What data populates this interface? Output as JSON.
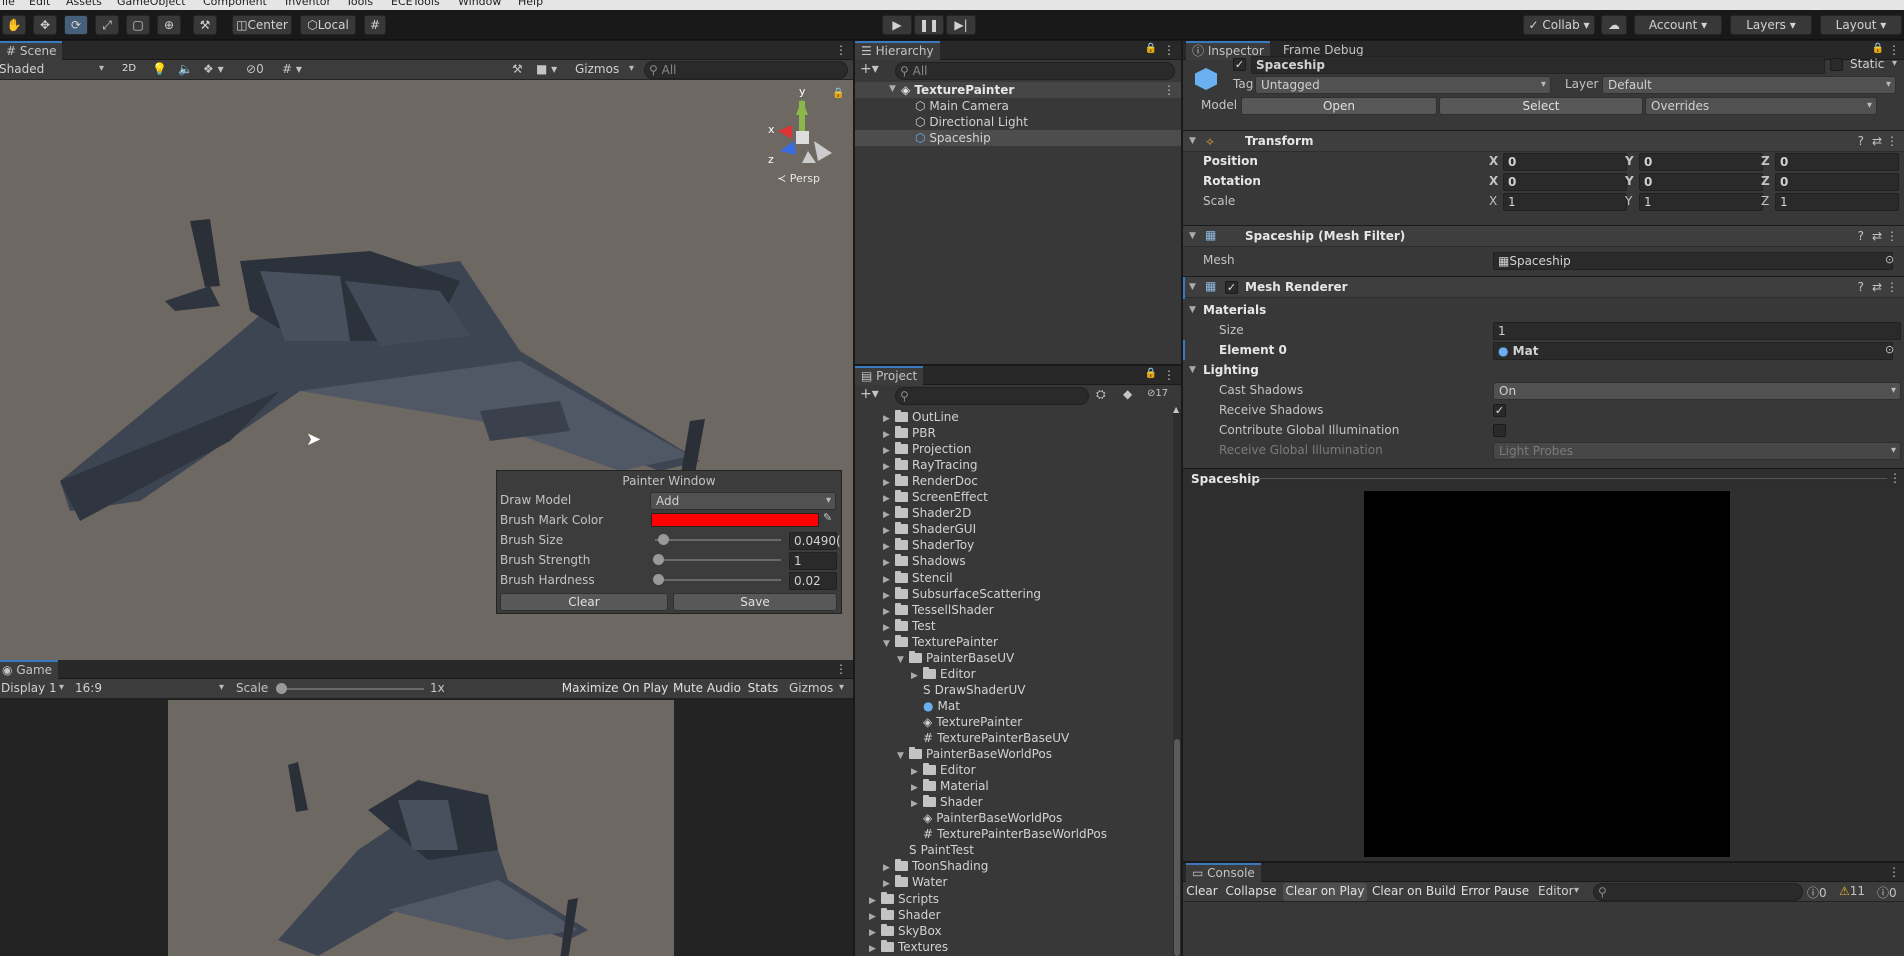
{
  "menubar": [
    "ile",
    "Edit",
    "Assets",
    "GameObject",
    "Component",
    "Inventor",
    "Tools",
    "ECETools",
    "Window",
    "Help"
  ],
  "toolbar": {
    "pivot_center": "Center",
    "pivot_local": "Local",
    "collab": "Collab",
    "account": "Account",
    "layers": "Layers",
    "layout": "Layout"
  },
  "scene": {
    "tab": "Scene",
    "shading": "Shaded",
    "mode_2d": "2D",
    "hidden_count": "0",
    "gizmos": "Gizmos",
    "search_placeholder": "All",
    "persp": "Persp",
    "axis_x": "x",
    "axis_y": "y",
    "axis_z": "z"
  },
  "painter": {
    "title": "Painter Window",
    "draw_model_label": "Draw Model",
    "draw_model_value": "Add",
    "color_label": "Brush Mark Color",
    "color_value": "#ff0000",
    "size_label": "Brush Size",
    "size_value": "0.0490(",
    "size_fraction": 0.04,
    "strength_label": "Brush Strength",
    "strength_value": "1",
    "strength_fraction": 0.0,
    "hardness_label": "Brush Hardness",
    "hardness_value": "0.02",
    "hardness_fraction": 0.0,
    "clear": "Clear",
    "save": "Save"
  },
  "game": {
    "tab": "Game",
    "display": "Display 1",
    "aspect": "16:9",
    "scale_label": "Scale",
    "scale_value": "1x",
    "maximize": "Maximize On Play",
    "mute": "Mute Audio",
    "stats": "Stats",
    "gizmos": "Gizmos"
  },
  "hierarchy": {
    "tab": "Hierarchy",
    "search_placeholder": "All",
    "scene": "TexturePainter",
    "items": [
      "Main Camera",
      "Directional Light",
      "Spaceship"
    ]
  },
  "project": {
    "tab": "Project",
    "hidden_count": "17",
    "items": [
      {
        "name": "OutLine",
        "indent": 1,
        "type": "folder",
        "arrow": "▶"
      },
      {
        "name": "PBR",
        "indent": 1,
        "type": "folder",
        "arrow": "▶"
      },
      {
        "name": "Projection",
        "indent": 1,
        "type": "folder",
        "arrow": "▶"
      },
      {
        "name": "RayTracing",
        "indent": 1,
        "type": "folder",
        "arrow": "▶"
      },
      {
        "name": "RenderDoc",
        "indent": 1,
        "type": "folder",
        "arrow": "▶"
      },
      {
        "name": "ScreenEffect",
        "indent": 1,
        "type": "folder",
        "arrow": "▶"
      },
      {
        "name": "Shader2D",
        "indent": 1,
        "type": "folder",
        "arrow": "▶"
      },
      {
        "name": "ShaderGUI",
        "indent": 1,
        "type": "folder",
        "arrow": "▶"
      },
      {
        "name": "ShaderToy",
        "indent": 1,
        "type": "folder",
        "arrow": "▶"
      },
      {
        "name": "Shadows",
        "indent": 1,
        "type": "folder",
        "arrow": "▶"
      },
      {
        "name": "Stencil",
        "indent": 1,
        "type": "folder",
        "arrow": "▶"
      },
      {
        "name": "SubsurfaceScattering",
        "indent": 1,
        "type": "folder",
        "arrow": "▶"
      },
      {
        "name": "TessellShader",
        "indent": 1,
        "type": "folder",
        "arrow": "▶"
      },
      {
        "name": "Test",
        "indent": 1,
        "type": "folder",
        "arrow": "▶"
      },
      {
        "name": "TexturePainter",
        "indent": 1,
        "type": "folder",
        "arrow": "▼"
      },
      {
        "name": "PainterBaseUV",
        "indent": 2,
        "type": "folder",
        "arrow": "▼"
      },
      {
        "name": "Editor",
        "indent": 3,
        "type": "folder",
        "arrow": "▶"
      },
      {
        "name": "DrawShaderUV",
        "indent": 3,
        "type": "shader",
        "arrow": ""
      },
      {
        "name": "Mat",
        "indent": 3,
        "type": "material",
        "arrow": ""
      },
      {
        "name": "TexturePainter",
        "indent": 3,
        "type": "scene",
        "arrow": ""
      },
      {
        "name": "TexturePainterBaseUV",
        "indent": 3,
        "type": "script",
        "arrow": ""
      },
      {
        "name": "PainterBaseWorldPos",
        "indent": 2,
        "type": "folder",
        "arrow": "▼"
      },
      {
        "name": "Editor",
        "indent": 3,
        "type": "folder",
        "arrow": "▶"
      },
      {
        "name": "Material",
        "indent": 3,
        "type": "folder",
        "arrow": "▶"
      },
      {
        "name": "Shader",
        "indent": 3,
        "type": "folder",
        "arrow": "▶"
      },
      {
        "name": "PainterBaseWorldPos",
        "indent": 3,
        "type": "scene",
        "arrow": ""
      },
      {
        "name": "TexturePainterBaseWorldPos",
        "indent": 3,
        "type": "script",
        "arrow": ""
      },
      {
        "name": "PaintTest",
        "indent": 2,
        "type": "shader",
        "arrow": ""
      },
      {
        "name": "ToonShading",
        "indent": 1,
        "type": "folder",
        "arrow": "▶"
      },
      {
        "name": "Water",
        "indent": 1,
        "type": "folder",
        "arrow": "▶"
      },
      {
        "name": "Scripts",
        "indent": 0,
        "type": "folder",
        "arrow": "▶"
      },
      {
        "name": "Shader",
        "indent": 0,
        "type": "folder",
        "arrow": "▶"
      },
      {
        "name": "SkyBox",
        "indent": 0,
        "type": "folder",
        "arrow": "▶"
      },
      {
        "name": "Textures",
        "indent": 0,
        "type": "folder",
        "arrow": "▶"
      }
    ]
  },
  "inspector": {
    "tab": "Inspector",
    "tab2": "Frame Debug",
    "object_name": "Spaceship",
    "static": "Static",
    "tag_label": "Tag",
    "tag_value": "Untagged",
    "layer_label": "Layer",
    "layer_value": "Default",
    "model_label": "Model",
    "open": "Open",
    "select": "Select",
    "overrides": "Overrides",
    "transform": {
      "title": "Transform",
      "position": "Position",
      "rotation": "Rotation",
      "scale": "Scale",
      "x": "X",
      "y": "Y",
      "z": "Z",
      "pos": [
        "0",
        "0",
        "0"
      ],
      "rot": [
        "0",
        "0",
        "0"
      ],
      "scl": [
        "1",
        "1",
        "1"
      ]
    },
    "meshfilter": {
      "title": "Spaceship (Mesh Filter)",
      "mesh_label": "Mesh",
      "mesh_value": "Spaceship"
    },
    "meshrenderer": {
      "title": "Mesh Renderer",
      "materials": "Materials",
      "size_label": "Size",
      "size_value": "1",
      "element_label": "Element 0",
      "element_value": "Mat",
      "lighting": "Lighting",
      "cast_label": "Cast Shadows",
      "cast_value": "On",
      "receive_label": "Receive Shadows",
      "contribute_label": "Contribute Global Illumination",
      "rgi_label": "Receive Global Illumination",
      "rgi_value": "Light Probes"
    },
    "preview_title": "Spaceship"
  },
  "console": {
    "tab": "Console",
    "clear": "Clear",
    "collapse": "Collapse",
    "clear_on_play": "Clear on Play",
    "clear_on_build": "Clear on Build",
    "error_pause": "Error Pause",
    "editor": "Editor",
    "info_count": "0",
    "warn_count": "11",
    "err_count": "0"
  },
  "colors": {
    "accent": "#3a79bb",
    "brush": "#ff0000",
    "scene_bg": "#6e6863"
  }
}
